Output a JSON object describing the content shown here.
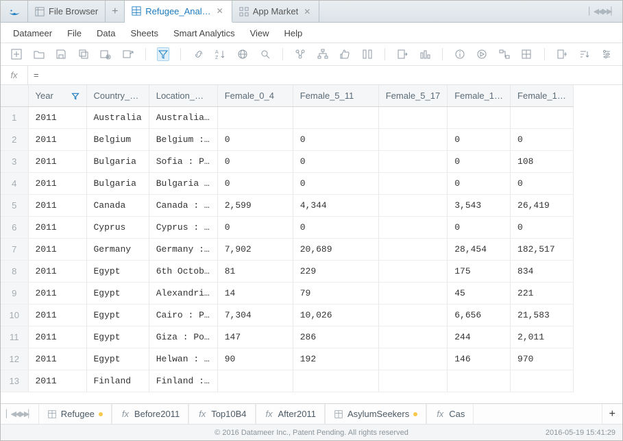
{
  "tabs": {
    "file_browser": "File Browser",
    "refugee": "Refugee_Anal…",
    "app_market": "App Market"
  },
  "menu": {
    "datameer": "Datameer",
    "file": "File",
    "data": "Data",
    "sheets": "Sheets",
    "smart": "Smart Analytics",
    "view": "View",
    "help": "Help"
  },
  "fx": {
    "label": "fx",
    "eq": "="
  },
  "columns": {
    "rownum": "",
    "year": "Year",
    "country": "Country_…",
    "location": "Location_…",
    "f04": "Female_0_4",
    "f511": "Female_5_11",
    "f517": "Female_5_17",
    "f1": "Female_1…",
    "f2": "Female_1…"
  },
  "rows": [
    {
      "n": "1",
      "year": "2011",
      "country": "Australia",
      "location": "Australia…",
      "f04": "",
      "f511": "",
      "f517": "",
      "f1": "",
      "f2": ""
    },
    {
      "n": "2",
      "year": "2011",
      "country": "Belgium",
      "location": "Belgium :…",
      "f04": "0",
      "f511": "0",
      "f517": "",
      "f1": "0",
      "f2": "0"
    },
    {
      "n": "3",
      "year": "2011",
      "country": "Bulgaria",
      "location": "Sofia : P…",
      "f04": "0",
      "f511": "0",
      "f517": "",
      "f1": "0",
      "f2": "108"
    },
    {
      "n": "4",
      "year": "2011",
      "country": "Bulgaria",
      "location": "Bulgaria …",
      "f04": "0",
      "f511": "0",
      "f517": "",
      "f1": "0",
      "f2": "0"
    },
    {
      "n": "5",
      "year": "2011",
      "country": "Canada",
      "location": "Canada : …",
      "f04": "2,599",
      "f511": "4,344",
      "f517": "",
      "f1": "3,543",
      "f2": "26,419"
    },
    {
      "n": "6",
      "year": "2011",
      "country": "Cyprus",
      "location": "Cyprus : …",
      "f04": "0",
      "f511": "0",
      "f517": "",
      "f1": "0",
      "f2": "0"
    },
    {
      "n": "7",
      "year": "2011",
      "country": "Germany",
      "location": "Germany :…",
      "f04": "7,902",
      "f511": "20,689",
      "f517": "",
      "f1": "28,454",
      "f2": "182,517"
    },
    {
      "n": "8",
      "year": "2011",
      "country": "Egypt",
      "location": "6th Octob…",
      "f04": "81",
      "f511": "229",
      "f517": "",
      "f1": "175",
      "f2": "834"
    },
    {
      "n": "9",
      "year": "2011",
      "country": "Egypt",
      "location": "Alexandri…",
      "f04": "14",
      "f511": "79",
      "f517": "",
      "f1": "45",
      "f2": "221"
    },
    {
      "n": "10",
      "year": "2011",
      "country": "Egypt",
      "location": "Cairo : P…",
      "f04": "7,304",
      "f511": "10,026",
      "f517": "",
      "f1": "6,656",
      "f2": "21,583"
    },
    {
      "n": "11",
      "year": "2011",
      "country": "Egypt",
      "location": "Giza : Po…",
      "f04": "147",
      "f511": "286",
      "f517": "",
      "f1": "244",
      "f2": "2,011"
    },
    {
      "n": "12",
      "year": "2011",
      "country": "Egypt",
      "location": "Helwan : …",
      "f04": "90",
      "f511": "192",
      "f517": "",
      "f1": "146",
      "f2": "970"
    },
    {
      "n": "13",
      "year": "2011",
      "country": "Finland",
      "location": "Finland :…",
      "f04": "",
      "f511": "",
      "f517": "",
      "f1": "",
      "f2": ""
    }
  ],
  "sheets": {
    "refugee": "Refugee",
    "before": "Before2011",
    "top": "Top10B4",
    "after": "After2011",
    "asylum": "AsylumSeekers",
    "cas": "Cas"
  },
  "footer": {
    "copyright": "© 2016 Datameer Inc., Patent Pending. All rights reserved",
    "timestamp": "2016-05-19 15:41:29"
  }
}
